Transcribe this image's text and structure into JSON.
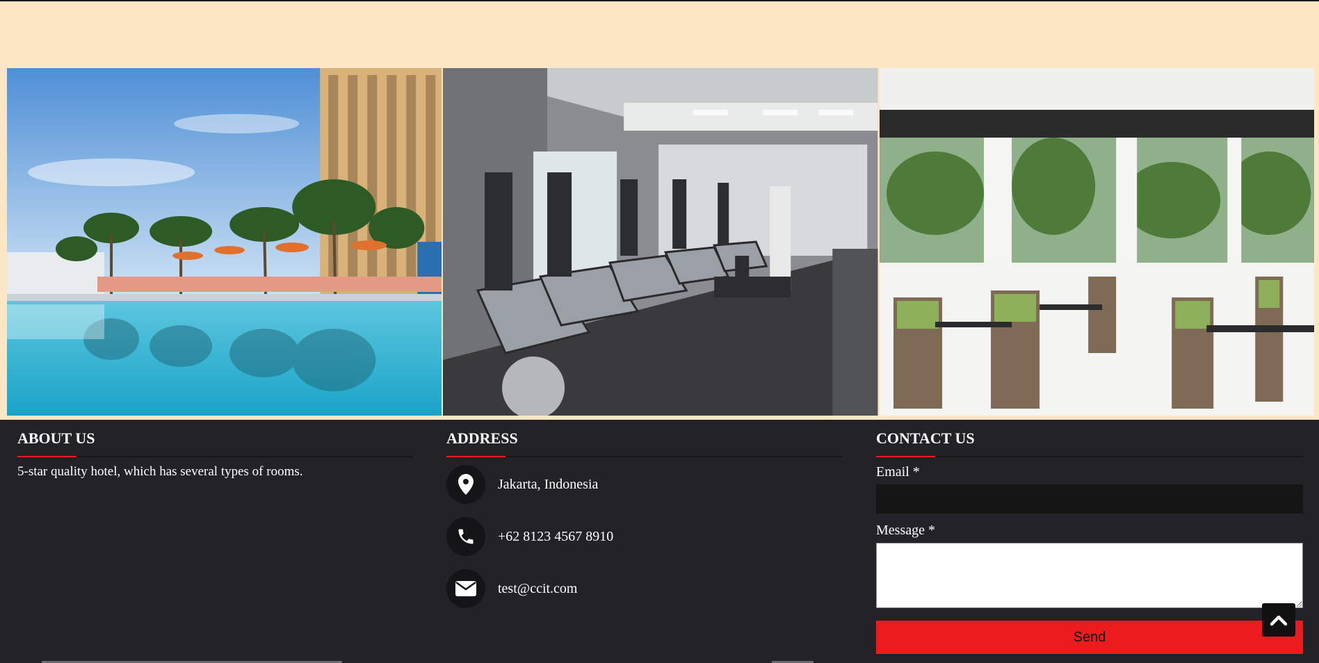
{
  "gallery": [
    {
      "name": "pool-photo",
      "alt": "Hotel pool with palm trees"
    },
    {
      "name": "gym-photo",
      "alt": "Fitness center with treadmills"
    },
    {
      "name": "restaurant-photo",
      "alt": "Restaurant dining area"
    }
  ],
  "about": {
    "title": "ABOUT US",
    "text": "5-star quality hotel, which has several types of rooms."
  },
  "address": {
    "title": "ADDRESS",
    "items": [
      {
        "icon": "map-pin-icon",
        "text": "Jakarta, Indonesia"
      },
      {
        "icon": "phone-icon",
        "text": "+62 8123 4567 8910"
      },
      {
        "icon": "envelope-icon",
        "text": "test@ccit.com"
      }
    ]
  },
  "contact": {
    "title": "CONTACT US",
    "email_label": "Email *",
    "email_value": "",
    "message_label": "Message *",
    "message_value": "",
    "send_label": "Send"
  },
  "scroll_top": {
    "icon": "chevron-up-icon"
  },
  "colors": {
    "accent": "#ec1c1e",
    "footer_bg": "#232327",
    "page_bg": "#fde6c4"
  }
}
